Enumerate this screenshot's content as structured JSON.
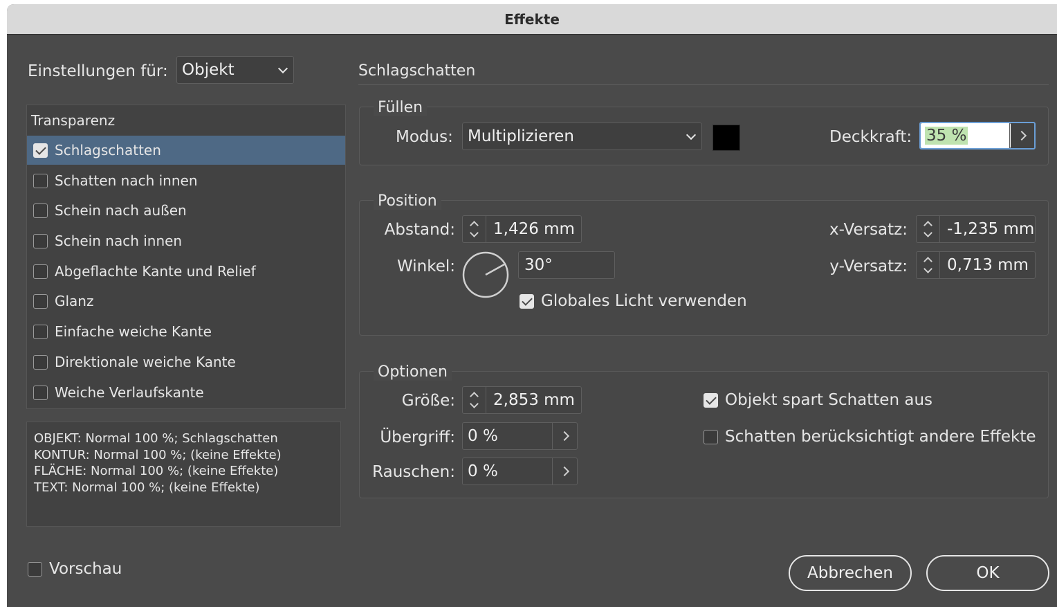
{
  "window": {
    "title": "Effekte"
  },
  "settings_for": {
    "label": "Einstellungen für:",
    "value": "Objekt"
  },
  "effects_list": {
    "header": "Transparenz",
    "items": [
      {
        "label": "Schlagschatten",
        "checked": true,
        "selected": true
      },
      {
        "label": "Schatten nach innen",
        "checked": false
      },
      {
        "label": "Schein nach außen",
        "checked": false
      },
      {
        "label": "Schein nach innen",
        "checked": false
      },
      {
        "label": "Abgeflachte Kante und Relief",
        "checked": false
      },
      {
        "label": "Glanz",
        "checked": false
      },
      {
        "label": "Einfache weiche Kante",
        "checked": false
      },
      {
        "label": "Direktionale weiche Kante",
        "checked": false
      },
      {
        "label": "Weiche Verlaufskante",
        "checked": false
      }
    ]
  },
  "summary": [
    "OBJEKT: Normal 100 %; Schlagschatten",
    "KONTUR: Normal 100 %; (keine Effekte)",
    "FLÄCHE: Normal 100 %; (keine Effekte)",
    "TEXT: Normal 100 %; (keine Effekte)"
  ],
  "section_title": "Schlagschatten",
  "fill": {
    "title": "Füllen",
    "mode_label": "Modus:",
    "mode_value": "Multiplizieren",
    "swatch_color": "#000000",
    "opacity_label": "Deckkraft:",
    "opacity_value": "35 %"
  },
  "position": {
    "title": "Position",
    "distance_label": "Abstand:",
    "distance_value": "1,426 mm",
    "angle_label": "Winkel:",
    "angle_value": "30°",
    "global_light_label": "Globales Licht verwenden",
    "global_light_checked": true,
    "x_offset_label": "x-Versatz:",
    "x_offset_value": "-1,235 mm",
    "y_offset_label": "y-Versatz:",
    "y_offset_value": "0,713 mm"
  },
  "options": {
    "title": "Optionen",
    "size_label": "Größe:",
    "size_value": "2,853 mm",
    "spread_label": "Übergriff:",
    "spread_value": "0 %",
    "noise_label": "Rauschen:",
    "noise_value": "0 %",
    "knockout_label": "Objekt spart Schatten aus",
    "knockout_checked": true,
    "honor_effects_label": "Schatten berücksichtigt andere Effekte",
    "honor_effects_checked": false
  },
  "preview": {
    "label": "Vorschau",
    "checked": false
  },
  "buttons": {
    "cancel": "Abbrechen",
    "ok": "OK"
  }
}
